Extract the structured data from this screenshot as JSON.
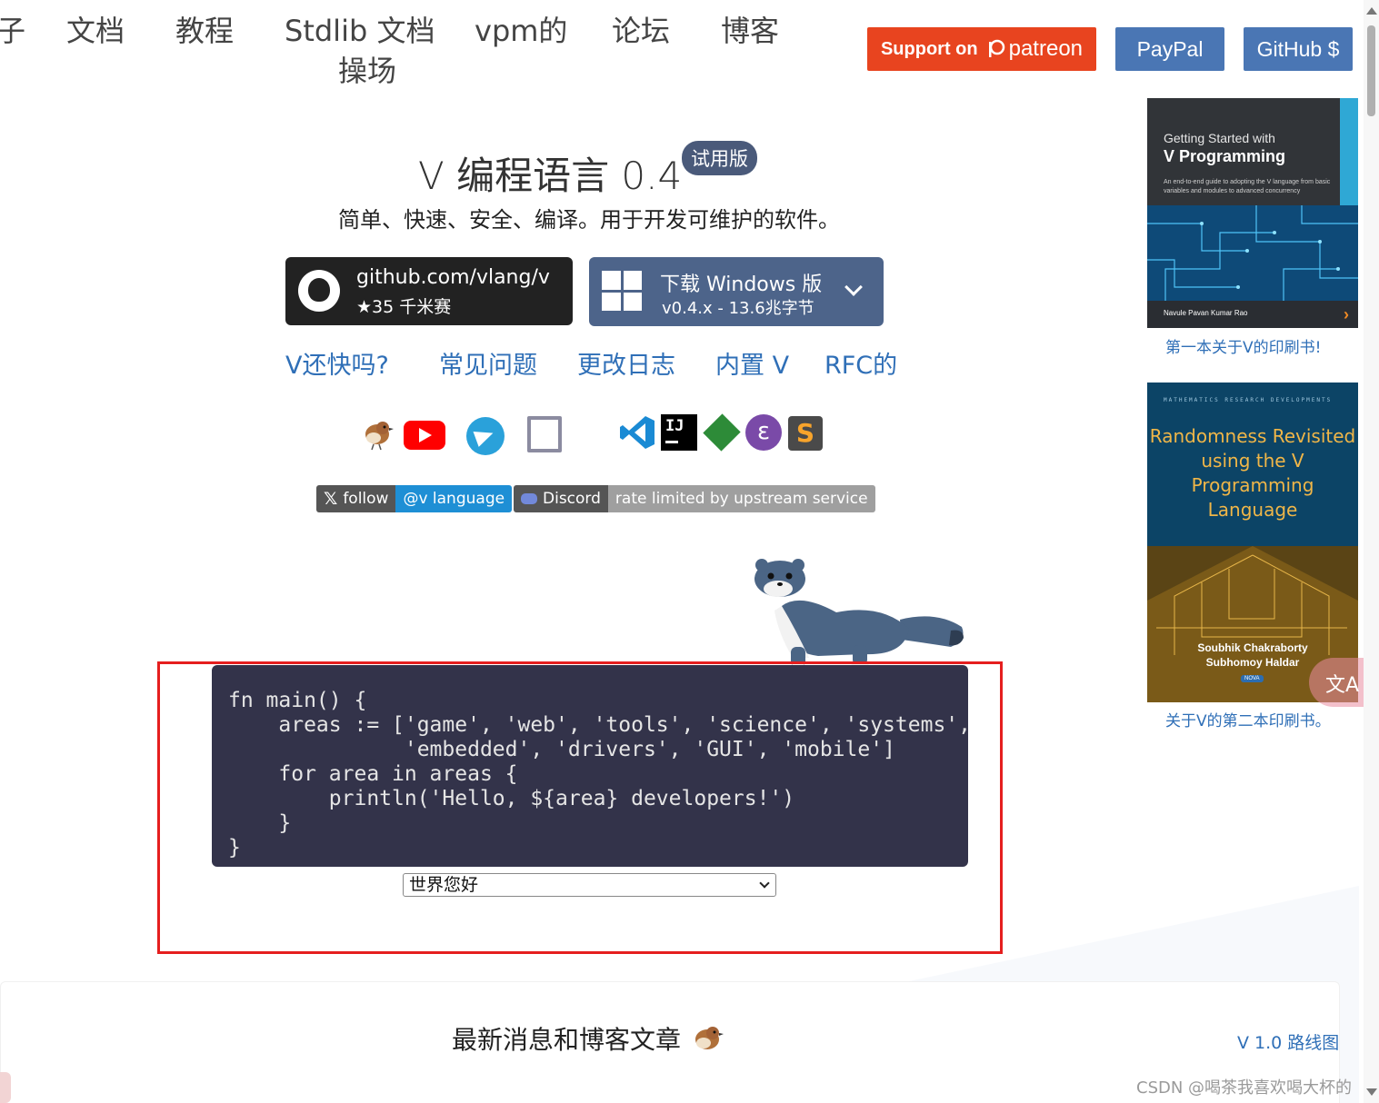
{
  "nav": {
    "items": [
      "子",
      "文档",
      "教程",
      "Stdlib 文档",
      "vpm的",
      "论坛",
      "博客"
    ],
    "playground_line1": "操场"
  },
  "top_buttons": {
    "patreon_prefix": "Support on",
    "patreon_brand": "patreon",
    "paypal": "PayPal",
    "github": "GitHub $"
  },
  "hero": {
    "title": "V 编程语言 0.4",
    "badge": "试用版",
    "tagline": "简单、快速、安全、编译。用于开发可维护的软件。"
  },
  "repo": {
    "url": "github.com/vlang/v",
    "stars": "★35 千米赛"
  },
  "download": {
    "title": "下载 Windows 版",
    "sub": "v0.4.x - 13.6兆字节"
  },
  "links": [
    "V还快吗?",
    "常见问题",
    "更改日志",
    "内置 V",
    "RFC的"
  ],
  "icons": [
    "bird-icon",
    "youtube-icon",
    "telegram-icon",
    "twitch-icon",
    "vscode-icon",
    "intellij-icon",
    "vim-icon",
    "emacs-icon",
    "sublime-icon"
  ],
  "badges": {
    "x_left": "follow",
    "x_right": "@v language",
    "discord_left": "Discord",
    "discord_right": "rate limited by upstream service"
  },
  "code": {
    "source": "fn main() {\n    areas := ['game', 'web', 'tools', 'science', 'systems',\n              'embedded', 'drivers', 'GUI', 'mobile']\n    for area in areas {\n        println('Hello, ${area} developers!')\n    }\n}",
    "select_value": "世界您好"
  },
  "news": {
    "title": "最新消息和博客文章",
    "roadmap": "V 1.0 路线图"
  },
  "book1": {
    "line1": "Getting Started with",
    "line2": "V Programming",
    "desc": "An end-to-end guide to adopting the V language from basic variables and modules to advanced concurrency",
    "author": "Navule Pavan Kumar Rao",
    "caption": "第一本关于V的印刷书!"
  },
  "book2": {
    "series": "MATHEMATICS RESEARCH DEVELOPMENTS",
    "title": "Randomness Revisited using the V Programming Language",
    "author1": "Soubhik Chakraborty",
    "author2": "Subhomoy Haldar",
    "publisher": "NOVA",
    "caption": "关于V的第二本印刷书。"
  },
  "translate_fab": "文A",
  "watermark": "CSDN @喝茶我喜欢喝大杯的",
  "colors": {
    "patreon": "#e8441f",
    "button_blue": "#4a76b4",
    "link": "#2f6fb7",
    "code_bg": "#33334a",
    "highlight": "#e51e1e"
  }
}
